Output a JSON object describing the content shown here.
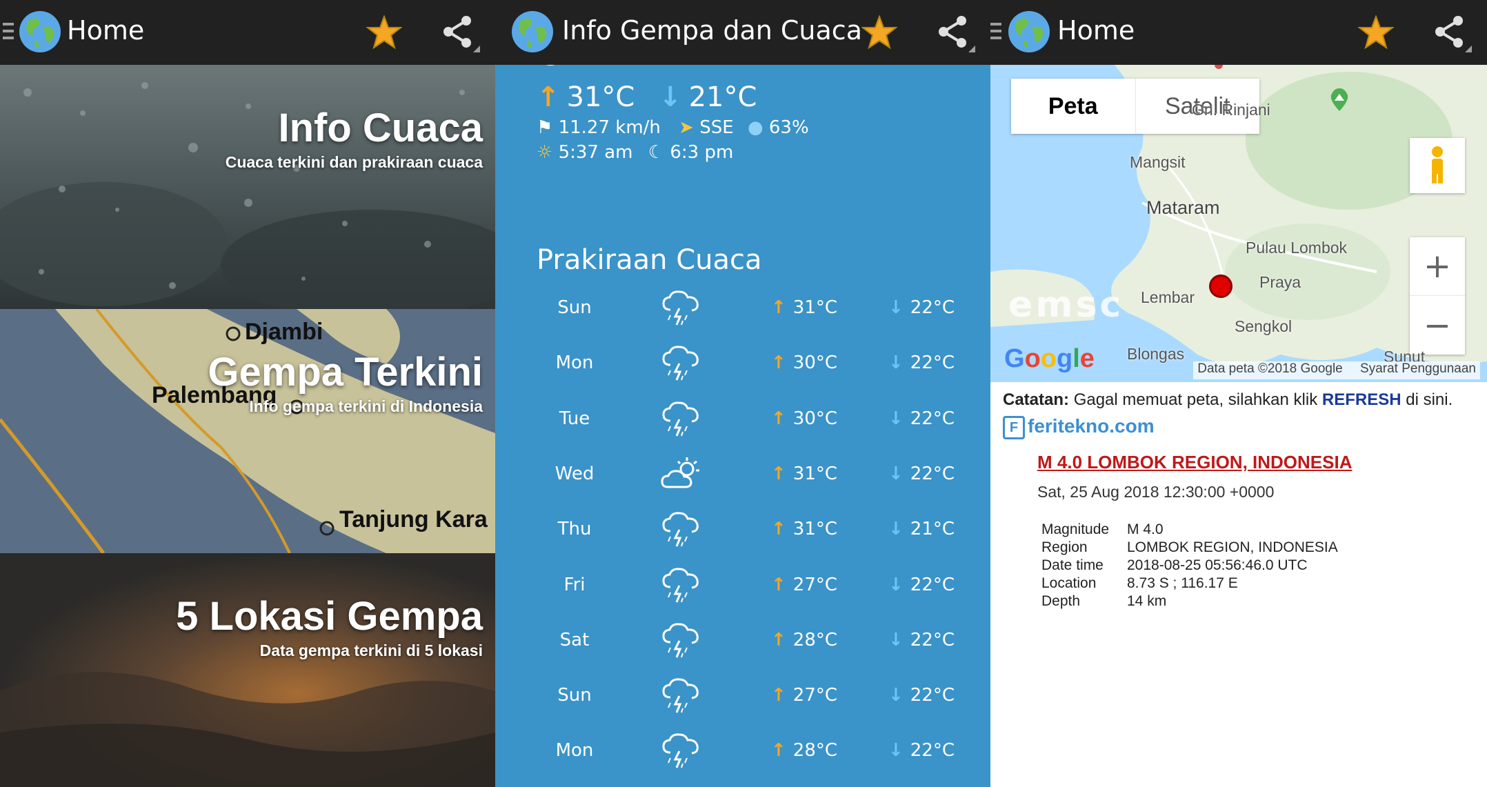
{
  "panels": {
    "home_left": {
      "appbar": {
        "title": "Home"
      },
      "cards": [
        {
          "title": "Info Cuaca",
          "subtitle": "Cuaca terkini dan prakiraan cuaca"
        },
        {
          "title": "Gempa Terkini",
          "subtitle": "Info gempa terkini di Indonesia",
          "map_labels": [
            "Djambi",
            "Palembang",
            "Tanjung Kara"
          ]
        },
        {
          "title": "5 Lokasi Gempa",
          "subtitle": "Data gempa terkini di 5 lokasi"
        }
      ]
    },
    "weather": {
      "appbar": {
        "title": "Info Gempa dan Cuaca"
      },
      "current": {
        "hi": "31°C",
        "lo": "21°C",
        "wind": "11.27 km/h",
        "direction": "SSE",
        "humidity": "63%",
        "sunrise": "5:37 am",
        "sunset": "6:3 pm"
      },
      "forecast_title": "Prakiraan Cuaca",
      "forecast": [
        {
          "day": "Sun",
          "icon": "thunderstorm-icon",
          "hi": "31°C",
          "lo": "22°C"
        },
        {
          "day": "Mon",
          "icon": "thunderstorm-icon",
          "hi": "30°C",
          "lo": "22°C"
        },
        {
          "day": "Tue",
          "icon": "thunderstorm-icon",
          "hi": "30°C",
          "lo": "22°C"
        },
        {
          "day": "Wed",
          "icon": "partly-cloudy-icon",
          "hi": "31°C",
          "lo": "22°C"
        },
        {
          "day": "Thu",
          "icon": "thunderstorm-icon",
          "hi": "31°C",
          "lo": "21°C"
        },
        {
          "day": "Fri",
          "icon": "thunderstorm-icon",
          "hi": "27°C",
          "lo": "22°C"
        },
        {
          "day": "Sat",
          "icon": "thunderstorm-icon",
          "hi": "28°C",
          "lo": "22°C"
        },
        {
          "day": "Sun",
          "icon": "thunderstorm-icon",
          "hi": "27°C",
          "lo": "22°C"
        },
        {
          "day": "Mon",
          "icon": "thunderstorm-icon",
          "hi": "28°C",
          "lo": "22°C"
        }
      ]
    },
    "home_right": {
      "appbar": {
        "title": "Home"
      },
      "map": {
        "tab_map": "Peta",
        "tab_satellite": "Satelit",
        "places": {
          "rinjani": "Gn. Rinjani",
          "mangsit": "Mangsit",
          "mataram": "Mataram",
          "pulau_lombok": "Pulau Lombok",
          "praya": "Praya",
          "lembar": "Lembar",
          "sengkol": "Sengkol",
          "blongas": "Blongas",
          "sunut": "Sunut"
        },
        "watermark": "emsc",
        "google": "Google",
        "copyright": "Data peta ©2018 Google",
        "terms": "Syarat Penggunaan"
      },
      "note": {
        "label": "Catatan:",
        "text": "Gagal memuat peta, silahkan klik",
        "refresh": "REFRESH",
        "suffix": "di sini."
      },
      "brand": "feritekno.com",
      "earthquake": {
        "title": "M 4.0 LOMBOK REGION, INDONESIA",
        "time": "Sat, 25 Aug 2018 12:30:00 +0000",
        "details": [
          {
            "key": "Magnitude",
            "value": "M 4.0"
          },
          {
            "key": "Region",
            "value": "LOMBOK REGION, INDONESIA"
          },
          {
            "key": "Date time",
            "value": "2018-08-25 05:56:46.0 UTC"
          },
          {
            "key": "Location",
            "value": "8.73 S ; 116.17 E"
          },
          {
            "key": "Depth",
            "value": "14 km"
          }
        ]
      }
    }
  },
  "colors": {
    "appbar": "#212121",
    "weather_bg": "#3a93c9",
    "arrow_up": "#f5a623",
    "arrow_down": "#6fc3f5",
    "eq_title": "#c01818",
    "refresh": "#1a3a9a",
    "brand": "#3b8fd4",
    "star": "#f5a623"
  }
}
